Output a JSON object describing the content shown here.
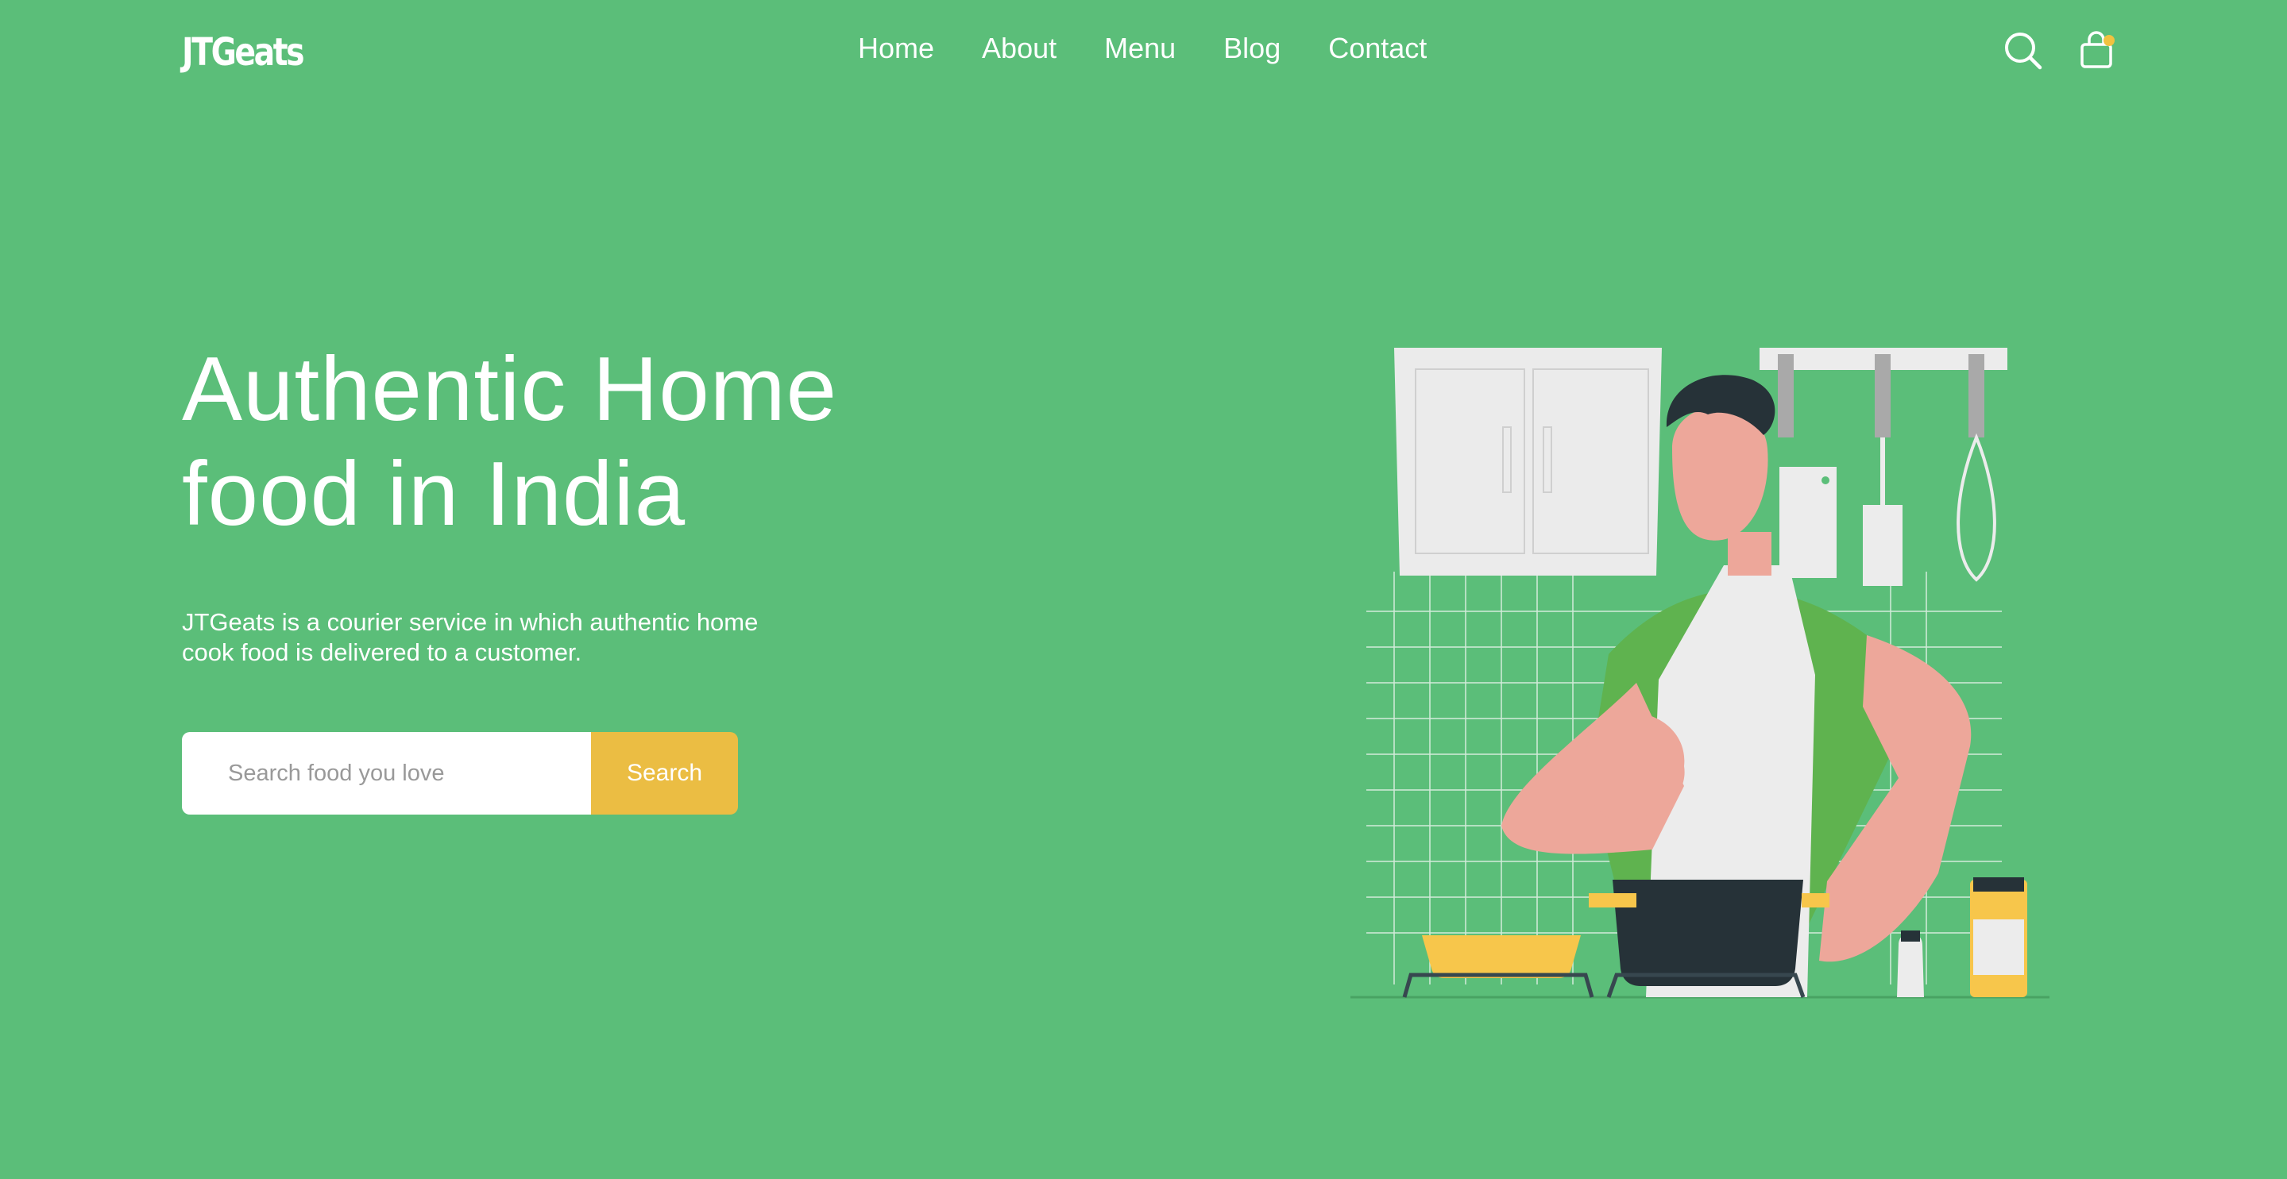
{
  "brand": {
    "logo_text": "JTGeats"
  },
  "nav": {
    "items": [
      {
        "label": "Home"
      },
      {
        "label": "About"
      },
      {
        "label": "Menu"
      },
      {
        "label": "Blog"
      },
      {
        "label": "Contact"
      }
    ]
  },
  "header_icons": {
    "search": "search-icon",
    "cart": "shopping-bag-icon"
  },
  "hero": {
    "title_line1": "Authentic Home",
    "title_line2": "food in India",
    "description": "JTGeats is a courier service in which authentic home cook food is delivered to a customer.",
    "search_placeholder": "Search food you love",
    "search_button": "Search"
  },
  "illustration": {
    "subject": "chef-cooking-illustration"
  },
  "colors": {
    "background": "#5bbe79",
    "accent": "#ebbd43",
    "text": "#ffffff"
  }
}
